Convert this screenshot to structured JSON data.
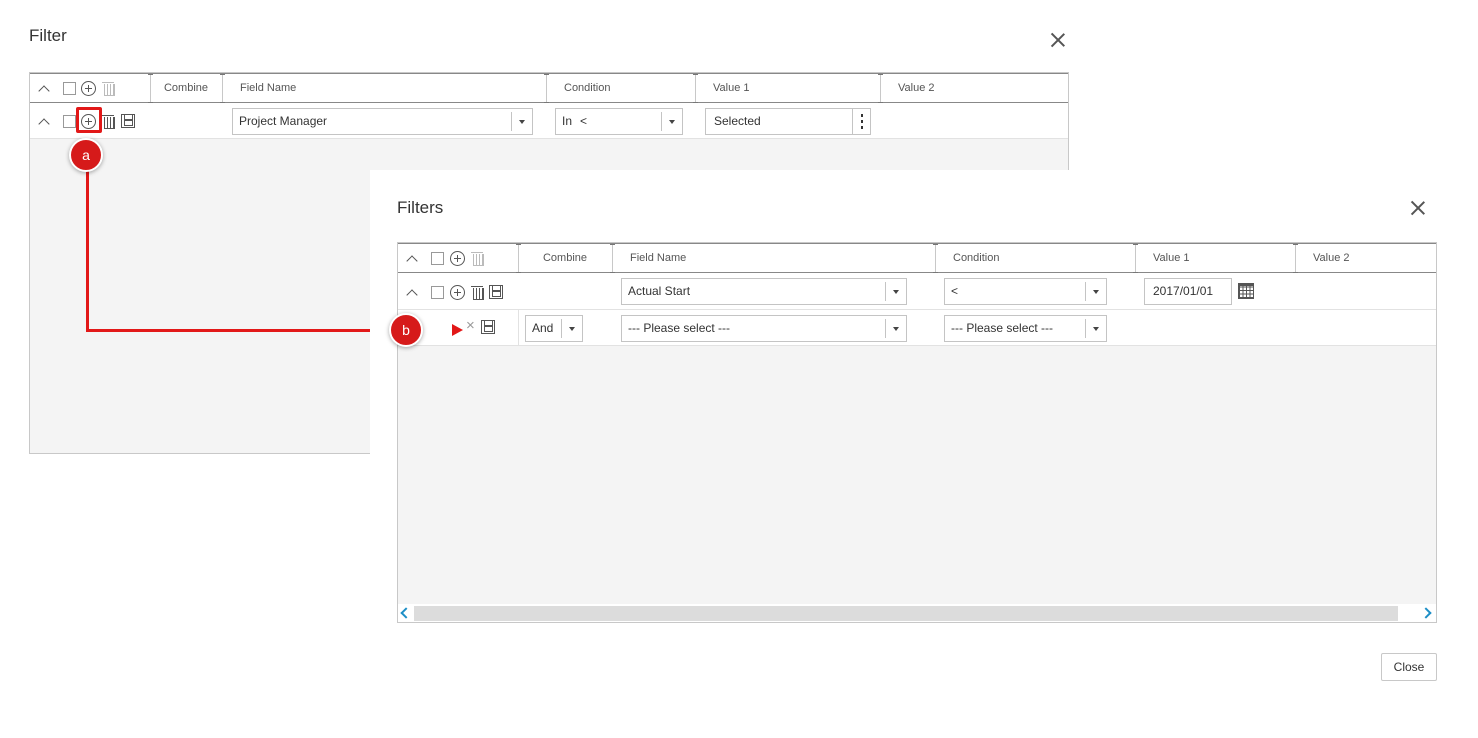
{
  "filter_dialog": {
    "title": "Filter",
    "headers": {
      "combine": "Combine",
      "field_name": "Field Name",
      "condition": "Condition",
      "value1": "Value 1",
      "value2": "Value 2"
    },
    "row1": {
      "field_name": "Project Manager",
      "condition": "In",
      "condition_extra": "<",
      "value1": "Selected"
    }
  },
  "filters_dialog": {
    "title": "Filters",
    "headers": {
      "combine": "Combine",
      "field_name": "Field Name",
      "condition": "Condition",
      "value1": "Value 1",
      "value2": "Value 2"
    },
    "row1": {
      "field_name": "Actual Start",
      "condition": "<",
      "value1": "2017/01/01"
    },
    "row2": {
      "combine": "And",
      "field_name": "--- Please select ---",
      "condition": "--- Please select ---"
    },
    "close_label": "Close"
  },
  "callouts": {
    "a": "a",
    "b": "b"
  },
  "colors": {
    "accent_red": "#d61a1a",
    "scroll_arrow": "#1e8fc6"
  },
  "icons": [
    "chevron-up-icon",
    "checkbox-icon",
    "add-circle-icon",
    "trash-icon",
    "save-icon",
    "calendar-icon",
    "close-icon",
    "more-vertical-icon"
  ]
}
